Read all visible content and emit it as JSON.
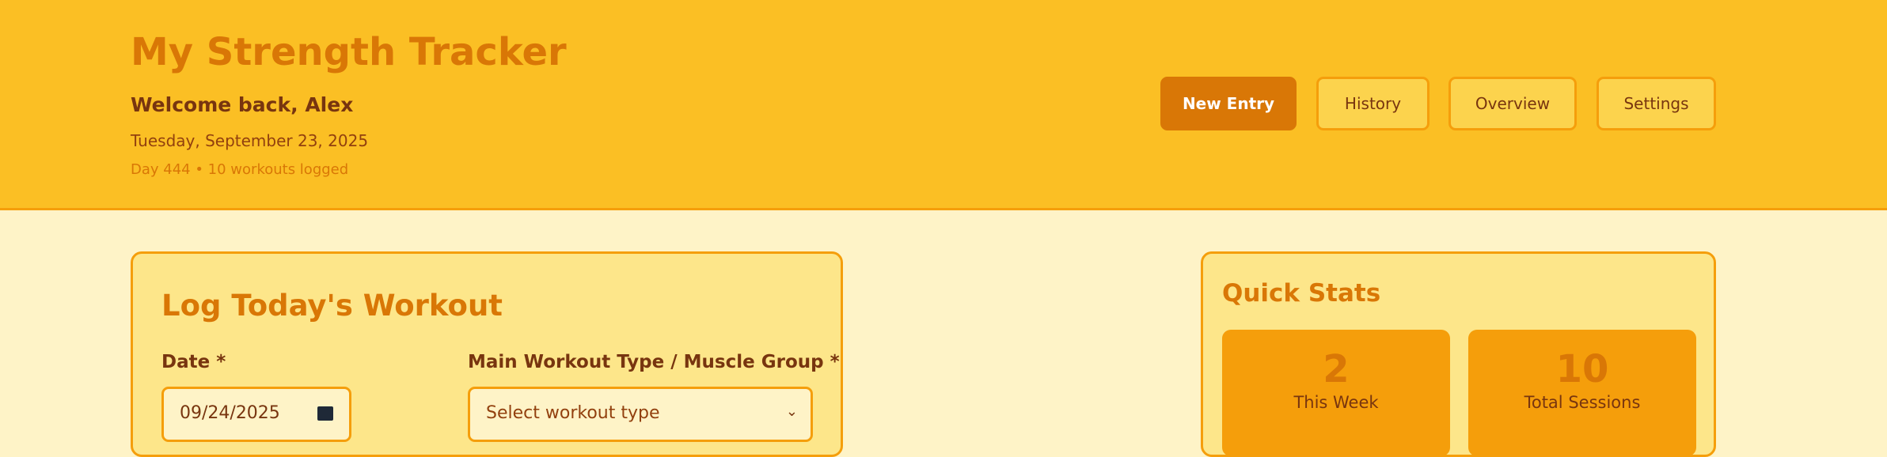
{
  "header": {
    "title": "My Strength Tracker",
    "welcome": "Welcome back, Alex",
    "date": "Tuesday, September 23, 2025",
    "stats": "Day 444 • 10 workouts logged"
  },
  "nav": [
    {
      "label": "New Entry",
      "active": true
    },
    {
      "label": "History",
      "active": false
    },
    {
      "label": "Overview",
      "active": false
    },
    {
      "label": "Settings",
      "active": false
    }
  ],
  "log_form": {
    "title": "Log Today's Workout",
    "date_label": "Date *",
    "date_value": "09/24/2025",
    "type_label": "Main Workout Type / Muscle Group *",
    "type_placeholder": "Select workout type"
  },
  "quick_stats": {
    "title": "Quick Stats",
    "tiles": [
      {
        "value": "2",
        "label": "This Week"
      },
      {
        "value": "10",
        "label": "Total Sessions"
      }
    ]
  },
  "colors": {
    "header_bg": "#fbbf24",
    "page_bg": "#fef3c7",
    "accent": "#d97706",
    "card_bg": "#fde68a",
    "border": "#f59e0b"
  }
}
